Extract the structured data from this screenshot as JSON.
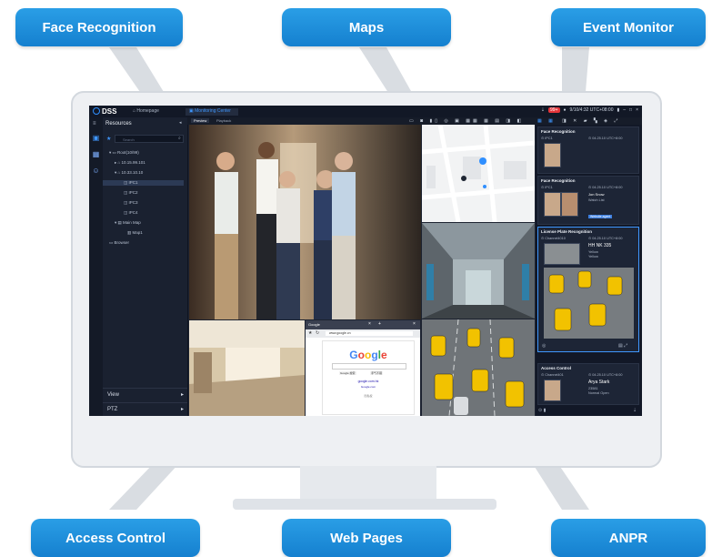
{
  "callouts": {
    "face_recognition": "Face Recognition",
    "maps": "Maps",
    "event_monitor": "Event Monitor",
    "access_control": "Access Control",
    "web_pages": "Web Pages",
    "anpr": "ANPR"
  },
  "app": {
    "logo": "DSS",
    "homepage_tab": "Homepage",
    "monitoring_tab": "Monitoring Center",
    "datetime": "9/10/4:32  UTC+08:00",
    "alarm_count": "99+"
  },
  "sidebar": {
    "title": "Resources",
    "search_placeholder": "Search",
    "tree": [
      {
        "label": "Root(10/99)",
        "depth": 0
      },
      {
        "label": "10.15.99.101",
        "depth": 1
      },
      {
        "label": "10.33.10.10",
        "depth": 1
      },
      {
        "label": "IPC1",
        "depth": 2,
        "selected": true
      },
      {
        "label": "IPC2",
        "depth": 2
      },
      {
        "label": "IPC3",
        "depth": 2
      },
      {
        "label": "IPC4",
        "depth": 2
      },
      {
        "label": "Main Map",
        "depth": 1
      },
      {
        "label": "Map1",
        "depth": 2
      },
      {
        "label": "Browser",
        "depth": 0
      }
    ],
    "bottom": [
      "View",
      "PTZ"
    ]
  },
  "video_tabs": [
    "Preview",
    "Playback"
  ],
  "panes": {
    "face": "People in corridor",
    "map": "Map",
    "mall": "Mall entrance",
    "lobby": "Lobby",
    "traffic": "Traffic"
  },
  "browser": {
    "tab": "Google",
    "url": "www.google.cn",
    "logo_letters": [
      "G",
      "o",
      "o",
      "g",
      "l",
      "e"
    ],
    "logo_colors": [
      "#4285f4",
      "#ea4335",
      "#fbbc05",
      "#4285f4",
      "#34a853",
      "#ea4335"
    ],
    "btn1": "Google 搜索",
    "btn2": "手气不错",
    "link1": "google.com.hk",
    "link2": "Google.com",
    "footer": "隐私权"
  },
  "events": {
    "card1": {
      "title": "Face Recognition",
      "ch": "IPC1",
      "time": "04.25.10 UTC+8:00"
    },
    "card2": {
      "title": "Face Recognition",
      "ch": "IPC1",
      "time": "04.25.10 UTC+8:00",
      "name": "Jon Snow",
      "list": "Watch List",
      "tag": "Website agent"
    },
    "card3": {
      "title": "License Plate Recognition",
      "ch": "Channel4010",
      "time": "04.25.10 UTC+8:00",
      "plate": "HH NK 335",
      "color": "Yellow",
      "type": "Yellow"
    },
    "card4": {
      "title": "Access Control",
      "ch": "Channel401",
      "time": "04.25.10 UTC+8:00",
      "name": "Arya Stark",
      "id": "23581",
      "status": "Normal Open"
    }
  },
  "colors": {
    "callout": "#1580cf",
    "accent": "#2f8fff",
    "screen_bg": "#1c2230"
  }
}
